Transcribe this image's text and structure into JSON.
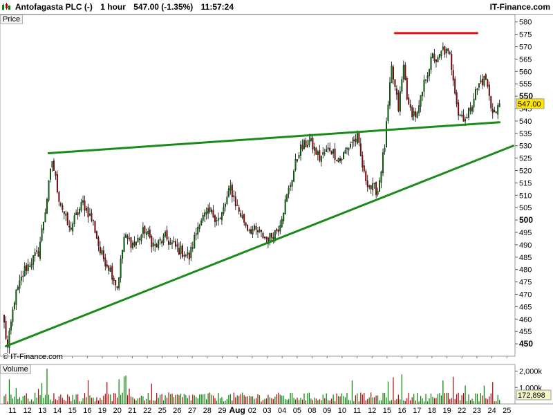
{
  "header": {
    "instrument": "Antofagasta PLC (-)",
    "interval": "1 hour",
    "last_change": "547.00 (-1.35%)",
    "time": "11:57:24",
    "brand": "IT-Finance.com"
  },
  "panels": {
    "price_label": "Price",
    "volume_label": "Volume",
    "watermark": "© IT-Finance.com"
  },
  "colors": {
    "up": "#008000",
    "down": "#b00000",
    "trendline": "#1a8a1a",
    "resistance": "#e01010",
    "last_price_bg": "#ffe600",
    "volume_box_bg": "#f5f5c8",
    "grid": "#d6d6d6"
  },
  "chart_data": {
    "type": "candlestick",
    "price_axis": {
      "ylim": [
        445,
        583
      ],
      "ticks": [
        450,
        455,
        460,
        465,
        470,
        475,
        480,
        485,
        490,
        495,
        500,
        505,
        510,
        515,
        520,
        525,
        530,
        535,
        540,
        545,
        550,
        555,
        560,
        565,
        570,
        575,
        580
      ],
      "bold_ticks": [
        450,
        500,
        550
      ]
    },
    "last_price": "547.00",
    "volume_axis": {
      "ticks": [
        "2,000k",
        "1,000k"
      ],
      "max": 2400,
      "last_volume": "172,898"
    },
    "x_labels": [
      "11",
      "12",
      "13",
      "14",
      "15",
      "16",
      "19",
      "20",
      "21",
      "22",
      "25",
      "26",
      "27",
      "28",
      "29",
      "Aug",
      "02",
      "03",
      "04",
      "05",
      "08",
      "09",
      "10",
      "11",
      "12",
      "15",
      "16",
      "17",
      "18",
      "19",
      "22",
      "23",
      "24",
      "25"
    ],
    "bold_x_label": "Aug",
    "price_path_anchors": [
      {
        "i": 0,
        "v": 458
      },
      {
        "i": 2,
        "v": 448
      },
      {
        "i": 6,
        "v": 468
      },
      {
        "i": 12,
        "v": 480
      },
      {
        "i": 20,
        "v": 487
      },
      {
        "i": 24,
        "v": 504
      },
      {
        "i": 28,
        "v": 524
      },
      {
        "i": 32,
        "v": 509
      },
      {
        "i": 38,
        "v": 496
      },
      {
        "i": 46,
        "v": 507
      },
      {
        "i": 52,
        "v": 499
      },
      {
        "i": 56,
        "v": 487
      },
      {
        "i": 62,
        "v": 480
      },
      {
        "i": 66,
        "v": 473
      },
      {
        "i": 70,
        "v": 493
      },
      {
        "i": 76,
        "v": 490
      },
      {
        "i": 82,
        "v": 496
      },
      {
        "i": 88,
        "v": 489
      },
      {
        "i": 94,
        "v": 493
      },
      {
        "i": 98,
        "v": 490
      },
      {
        "i": 102,
        "v": 488
      },
      {
        "i": 108,
        "v": 485
      },
      {
        "i": 114,
        "v": 500
      },
      {
        "i": 120,
        "v": 503
      },
      {
        "i": 126,
        "v": 500
      },
      {
        "i": 132,
        "v": 513
      },
      {
        "i": 136,
        "v": 505
      },
      {
        "i": 142,
        "v": 497
      },
      {
        "i": 148,
        "v": 495
      },
      {
        "i": 154,
        "v": 492
      },
      {
        "i": 160,
        "v": 497
      },
      {
        "i": 166,
        "v": 512
      },
      {
        "i": 172,
        "v": 528
      },
      {
        "i": 178,
        "v": 532
      },
      {
        "i": 184,
        "v": 525
      },
      {
        "i": 190,
        "v": 529
      },
      {
        "i": 196,
        "v": 524
      },
      {
        "i": 202,
        "v": 531
      },
      {
        "i": 206,
        "v": 533
      },
      {
        "i": 210,
        "v": 518
      },
      {
        "i": 214,
        "v": 513
      },
      {
        "i": 218,
        "v": 512
      },
      {
        "i": 222,
        "v": 530
      },
      {
        "i": 226,
        "v": 561
      },
      {
        "i": 230,
        "v": 545
      },
      {
        "i": 233,
        "v": 562
      },
      {
        "i": 236,
        "v": 545
      },
      {
        "i": 241,
        "v": 542
      },
      {
        "i": 246,
        "v": 558
      },
      {
        "i": 250,
        "v": 566
      },
      {
        "i": 253,
        "v": 564
      },
      {
        "i": 256,
        "v": 569
      },
      {
        "i": 260,
        "v": 566
      },
      {
        "i": 262,
        "v": 558
      },
      {
        "i": 265,
        "v": 543
      },
      {
        "i": 270,
        "v": 541
      },
      {
        "i": 274,
        "v": 550
      },
      {
        "i": 278,
        "v": 556
      },
      {
        "i": 281,
        "v": 557
      },
      {
        "i": 284,
        "v": 546
      },
      {
        "i": 287,
        "v": 543
      },
      {
        "i": 289,
        "v": 547
      }
    ],
    "candle_count": 290,
    "lines": [
      {
        "name": "upper-trendline",
        "color": "trendline",
        "from": {
          "i": 26,
          "v": 527
        },
        "to": {
          "i": 289,
          "v": 539.5
        }
      },
      {
        "name": "lower-trendline",
        "color": "trendline",
        "from": {
          "i": 1,
          "v": 449
        },
        "to": {
          "i": 297,
          "v": 530
        }
      },
      {
        "name": "resistance-line",
        "color": "resistance",
        "from": {
          "i": 228,
          "v": 575.5
        },
        "to": {
          "i": 276,
          "v": 575.5
        }
      }
    ]
  }
}
